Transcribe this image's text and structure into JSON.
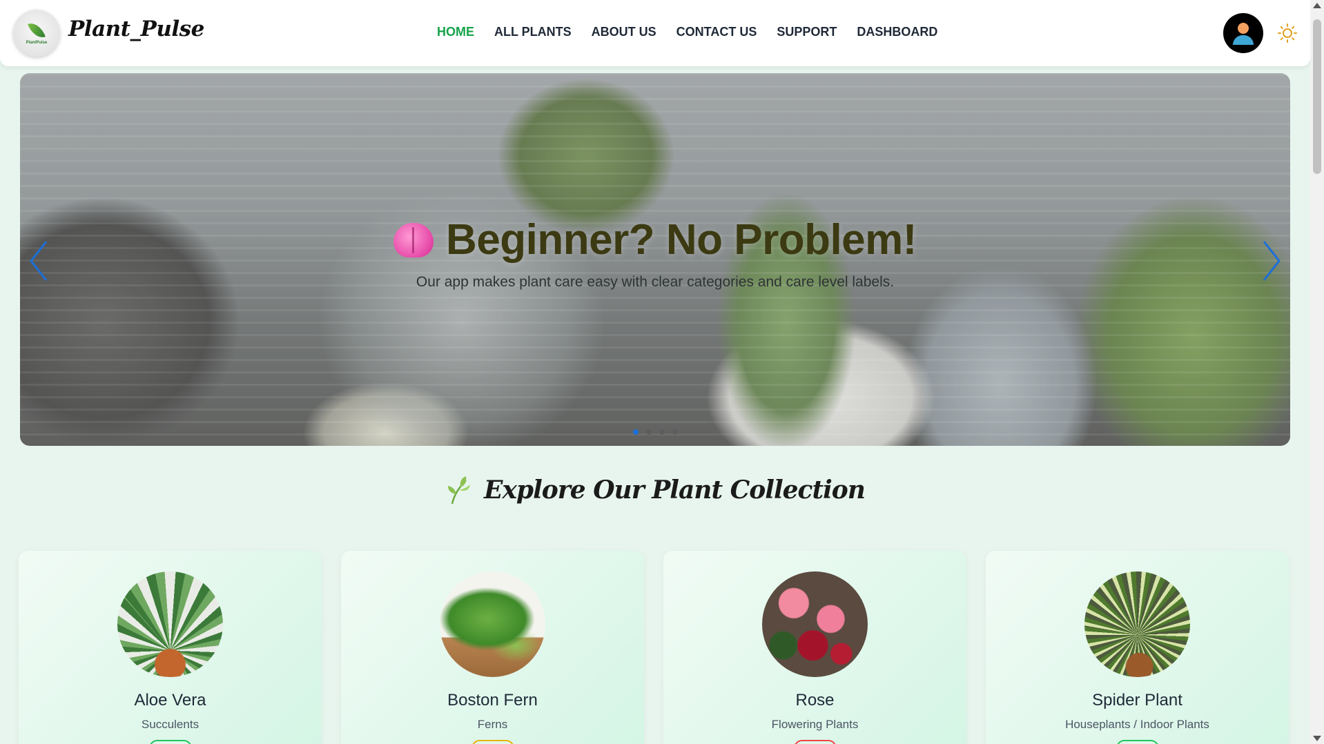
{
  "brand": {
    "name": "Plant_Pulse",
    "logo_text": "PlantPulse"
  },
  "nav": {
    "links": [
      {
        "label": "HOME",
        "active": true
      },
      {
        "label": "ALL PLANTS",
        "active": false
      },
      {
        "label": "ABOUT US",
        "active": false
      },
      {
        "label": "CONTACT US",
        "active": false
      },
      {
        "label": "SUPPORT",
        "active": false
      },
      {
        "label": "DASHBOARD",
        "active": false
      }
    ],
    "theme_toggle_icon": "sun-icon",
    "avatar_icon": "user-avatar-icon"
  },
  "hero": {
    "icon": "brain-icon",
    "title": "Beginner? No Problem!",
    "subtitle": "Our app makes plant care easy with clear categories and care level labels.",
    "slide_count": 4,
    "active_slide": 0
  },
  "collection": {
    "icon": "sprout-icon",
    "title": "Explore Our Plant Collection",
    "plants": [
      {
        "name": "Aloe Vera",
        "category": "Succulents",
        "badge_color": "#22c55e"
      },
      {
        "name": "Boston Fern",
        "category": "Ferns",
        "badge_color": "#eab308"
      },
      {
        "name": "Rose",
        "category": "Flowering Plants",
        "badge_color": "#ef4444"
      },
      {
        "name": "Spider Plant",
        "category": "Houseplants / Indoor Plants",
        "badge_color": "#22c55e"
      }
    ]
  },
  "colors": {
    "accent": "#16a34a",
    "page_bg": "#e8f5ee",
    "active_dot": "#1d6fd8"
  }
}
